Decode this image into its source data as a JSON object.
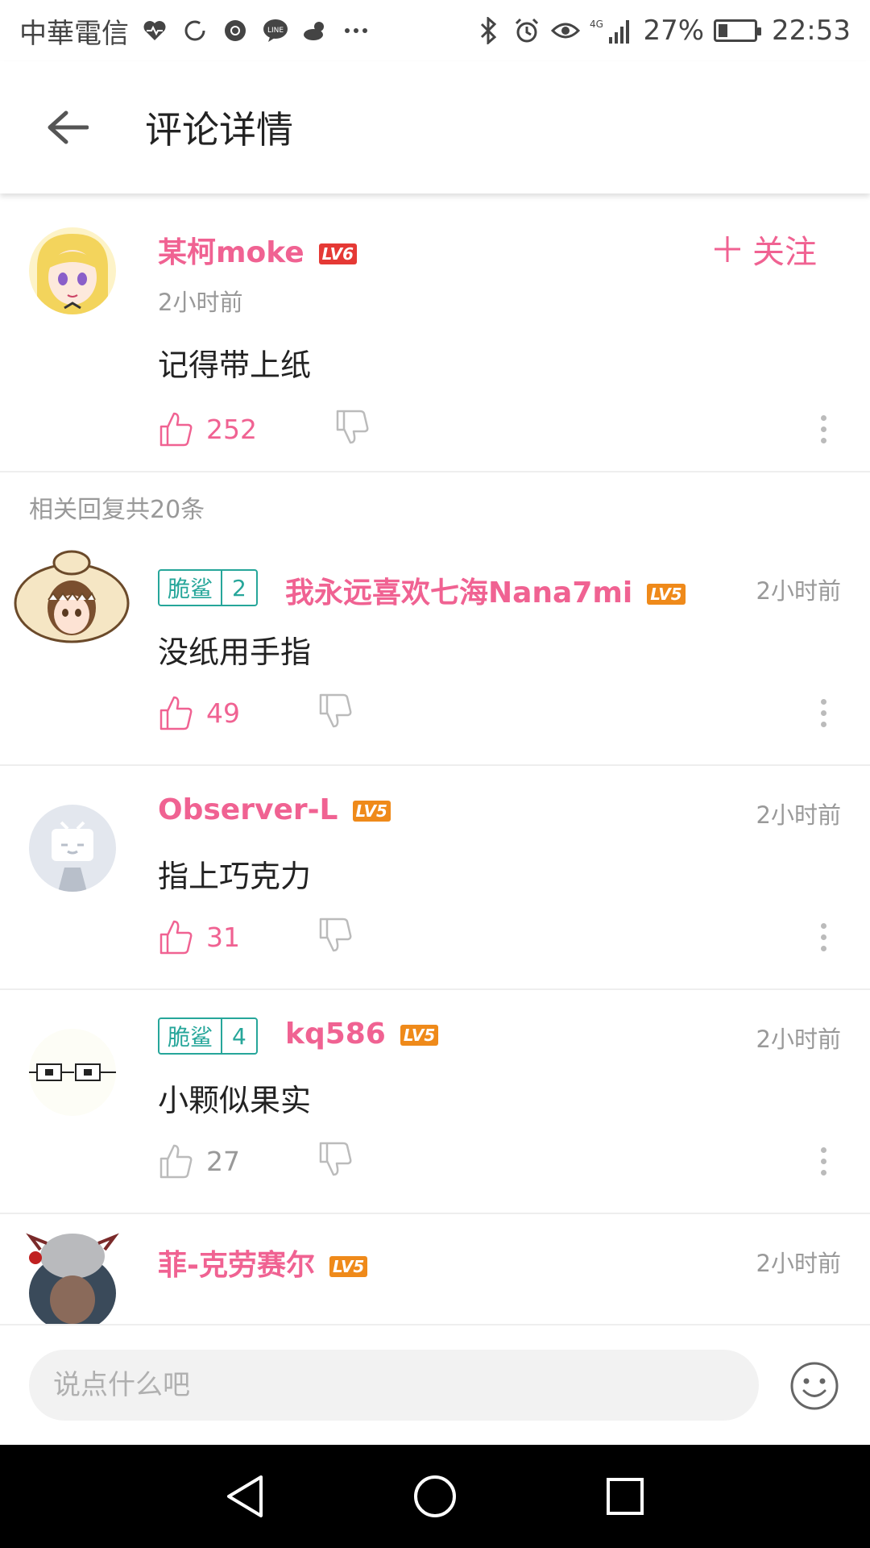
{
  "status_bar": {
    "carrier": "中華電信",
    "battery": "27%",
    "battery_level": 0.27,
    "time": "22:53",
    "network": "4G",
    "notification_icons": [
      "heartbeat-icon",
      "sync-icon",
      "chrome-icon",
      "line-icon",
      "weather-icon",
      "more-icon"
    ],
    "system_icons": [
      "bluetooth-icon",
      "alarm-icon",
      "eye-icon",
      "signal-icon",
      "battery-icon"
    ]
  },
  "header": {
    "title": "评论详情",
    "back_icon": "back-arrow-icon"
  },
  "main_comment": {
    "username": "某柯moke",
    "level": "LV6",
    "time": "2小时前",
    "text": "记得带上纸",
    "likes": "252",
    "follow_label": "关注",
    "liked": true
  },
  "replies_header": "相关回复共20条",
  "replies": [
    {
      "medal_name": "脆鲨",
      "medal_level": "2",
      "username": "我永远喜欢七海Nana7mi",
      "level": "LV5",
      "time": "2小时前",
      "text": "没纸用手指",
      "likes": "49",
      "liked": true
    },
    {
      "username": "Observer-L",
      "level": "LV5",
      "time": "2小时前",
      "text": "指上巧克力",
      "likes": "31",
      "liked": true
    },
    {
      "medal_name": "脆鲨",
      "medal_level": "4",
      "username": "kq586",
      "level": "LV5",
      "time": "2小时前",
      "text": "小颗似果实",
      "likes": "27",
      "liked": false
    },
    {
      "username": "菲-克劳赛尔",
      "level": "LV5",
      "time": "2小时前"
    }
  ],
  "input": {
    "placeholder": "说点什么吧"
  },
  "colors": {
    "accent": "#f06292",
    "medal": "#26a69a",
    "lv6": "#e53935",
    "lv5": "#ef8a1a"
  }
}
